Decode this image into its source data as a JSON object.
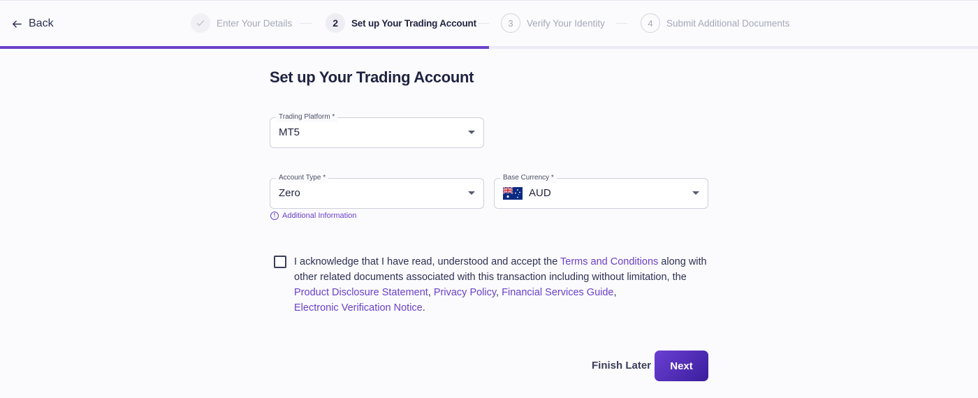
{
  "header": {
    "back_label": "Back",
    "steps": [
      {
        "number": "",
        "label": "Enter Your Details",
        "state": "done"
      },
      {
        "number": "2",
        "label": "Set up Your Trading Account",
        "state": "active"
      },
      {
        "number": "3",
        "label": "Verify Your Identity",
        "state": "pending"
      },
      {
        "number": "4",
        "label": "Submit Additional Documents",
        "state": "pending"
      }
    ],
    "progress": 0.5
  },
  "form": {
    "title": "Set up Your Trading Account",
    "trading_platform": {
      "label": "Trading Platform *",
      "value": "MT5"
    },
    "account_type": {
      "label": "Account Type *",
      "value": "Zero"
    },
    "base_currency": {
      "label": "Base Currency *",
      "value": "AUD",
      "flag": "australia-flag-icon"
    },
    "additional_info": "Additional Information",
    "acknowledgement": {
      "text_1": "I acknowledge that I have read, understood and accept the ",
      "link_terms": "Terms and Conditions",
      "text_2": " along with other related documents associated with this transaction including without limitation, the ",
      "link_pds": "Product Disclosure Statement",
      "sep_1": ", ",
      "link_privacy": "Privacy Policy",
      "sep_2": ", ",
      "link_fsg": "Financial Services Guide",
      "sep_3": ", ",
      "link_evn": "Electronic Verification Notice",
      "end": ".",
      "checked": false
    }
  },
  "actions": {
    "finish_later": "Finish Later",
    "next": "Next"
  },
  "colors": {
    "accent": "#6a40c8",
    "text": "#1f2340",
    "muted": "#a6a8b8"
  }
}
